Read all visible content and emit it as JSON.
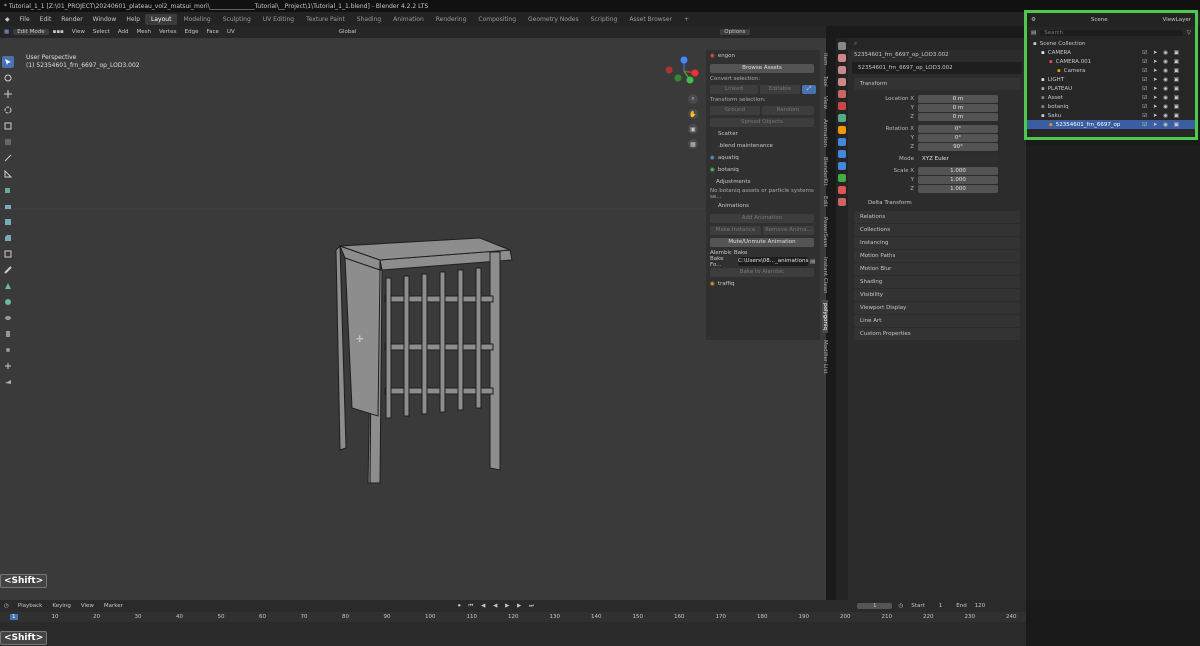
{
  "titlebar": {
    "text": "* Tutorial_1_1 [Z:\\01_PROJECT\\20240601_plateau_vol2_matsui_mori\\_______________Tutorial\\__Project\\1\\Tutorial_1_1.blend] - Blender 4.2.2 LTS"
  },
  "menu": [
    "File",
    "Edit",
    "Render",
    "Window",
    "Help"
  ],
  "workspaces": [
    "Layout",
    "Modeling",
    "Sculpting",
    "UV Editing",
    "Texture Paint",
    "Shading",
    "Animation",
    "Rendering",
    "Compositing",
    "Geometry Nodes",
    "Scripting",
    "Asset Browser",
    "+"
  ],
  "scene": {
    "name": "Scene",
    "view_layer": "ViewLayer"
  },
  "header3d": {
    "mode": "Edit Mode",
    "items": [
      "View",
      "Select",
      "Add",
      "Mesh",
      "Vertex",
      "Edge",
      "Face",
      "UV"
    ],
    "orientation": "Global",
    "options": "Options"
  },
  "viewport": {
    "perspective": "User Perspective",
    "object": "(1) 52354601_frn_6697_op_LOD3.002"
  },
  "npanel": {
    "addon": "engon",
    "browse": "Browse Assets",
    "convert_label": "Convert selection:",
    "linked": "Linked",
    "editable": "Editable",
    "transform_label": "Transform selection:",
    "ground": "Ground",
    "randomize": "Random",
    "spread": "Spread Objects",
    "scatter": "Scatter",
    "blend_maint": ".blend maintenance",
    "aquatiq": "aquatiq",
    "botaniq": "botaniq",
    "adjustments": "Adjustments",
    "no_assets": "No botaniq assets or particle systems se...",
    "animations": "Animations",
    "add_anim": "Add Animation",
    "make_inst": "Make Instance",
    "remove_anim": "Remove Anima...",
    "mute": "Mute/Unmute Animation",
    "alembic": "Alembic Bake",
    "bake_fo": "Bake Fo...",
    "bake_path": "C:\\Users\\08..._animations",
    "bake_btn": "Bake to Alembic",
    "traffiq": "traffiq"
  },
  "vtabs": [
    "Item",
    "Tool",
    "View",
    "Animation",
    "BlenderKit",
    "Edit",
    "PowerSave",
    "Instant Clean",
    "polygoniq",
    "Modifier List"
  ],
  "props": {
    "object": "52354601_frn_6697_op_LOD3.002",
    "data_name": "52354601_frn_6697_op_LOD3.002",
    "transform": "Transform",
    "location_label": "Location X",
    "loc": [
      "0 m",
      "0 m",
      "0 m"
    ],
    "rotation_label": "Rotation X",
    "rot": [
      "0°",
      "0°",
      "90°"
    ],
    "mode_label": "Mode",
    "mode": "XYZ Euler",
    "scale_label": "Scale X",
    "scale": [
      "1.000",
      "1.000",
      "1.000"
    ],
    "y": "Y",
    "z": "Z",
    "delta": "Delta Transform",
    "sections": [
      "Relations",
      "Collections",
      "Instancing",
      "Motion Paths",
      "Motion Blur",
      "Shading",
      "Visibility",
      "Viewport Display",
      "Line Art",
      "Custom Properties"
    ]
  },
  "outliner": {
    "search_placeholder": "Search",
    "rows": [
      {
        "label": "Scene Collection",
        "indent": 0
      },
      {
        "label": "CAMERA",
        "indent": 1
      },
      {
        "label": "CAMERA.001",
        "indent": 2
      },
      {
        "label": "Camera",
        "indent": 3
      },
      {
        "label": "LIGHT",
        "indent": 1
      },
      {
        "label": "PLATEAU",
        "indent": 1
      },
      {
        "label": "Asset",
        "indent": 1
      },
      {
        "label": "botaniq",
        "indent": 1
      },
      {
        "label": "Saku",
        "indent": 1
      },
      {
        "label": "52354601_frn_6697_op",
        "indent": 2
      }
    ]
  },
  "timeline": {
    "menus": [
      "Playback",
      "Keying",
      "View",
      "Marker"
    ],
    "current": "1",
    "start_label": "Start",
    "start": "1",
    "end_label": "End",
    "end": "120",
    "ticks": [
      "1",
      "10",
      "20",
      "30",
      "40",
      "50",
      "60",
      "70",
      "80",
      "90",
      "100",
      "110",
      "120",
      "130",
      "140",
      "150",
      "160",
      "170",
      "180",
      "190",
      "200",
      "210",
      "220",
      "230",
      "240"
    ]
  },
  "keycast": "<Shift>"
}
